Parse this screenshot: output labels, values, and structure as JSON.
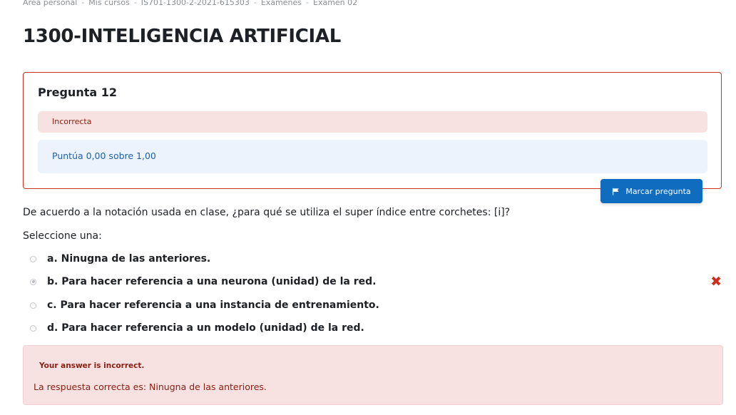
{
  "breadcrumb": [
    "Área personal",
    "Mis cursos",
    "IS701-1300-2-2021-615303",
    "Exámenes",
    "Examen 02"
  ],
  "breadcrumb_separator": "-",
  "page_title": "1300-INTELIGENCIA ARTIFICIAL",
  "question": {
    "heading": "Pregunta 12",
    "state": "Incorrecta",
    "grade": "Puntúa 0,00 sobre 1,00",
    "flag_label": "Marcar pregunta",
    "text": "De acuerdo a la notación usada en clase, ¿para qué se utiliza el super índice entre corchetes: [i]?",
    "prompt": "Seleccione una:",
    "options": [
      {
        "label": "a. Ninugna de las anteriores."
      },
      {
        "label": "b. Para hacer referencia a una neurona (unidad) de la red."
      },
      {
        "label": "c. Para hacer referencia a una instancia de entrenamiento."
      },
      {
        "label": "d. Para hacer referencia a un modelo (unidad) de la red."
      }
    ],
    "selected_option": "b",
    "wrong_mark": "✖"
  },
  "feedback": {
    "status": "Your answer is incorrect.",
    "correct_answer": "La respuesta correcta es: Ninugna de las anteriores."
  },
  "colors": {
    "border_incorrect": "#ca3120",
    "state_bg": "#f8e1e1",
    "grade_bg": "#ecf3fd",
    "primary_button": "#0f6cbf"
  },
  "icons": {
    "flag": "flag-icon",
    "wrong": "times-icon",
    "radio": "radio-icon"
  }
}
